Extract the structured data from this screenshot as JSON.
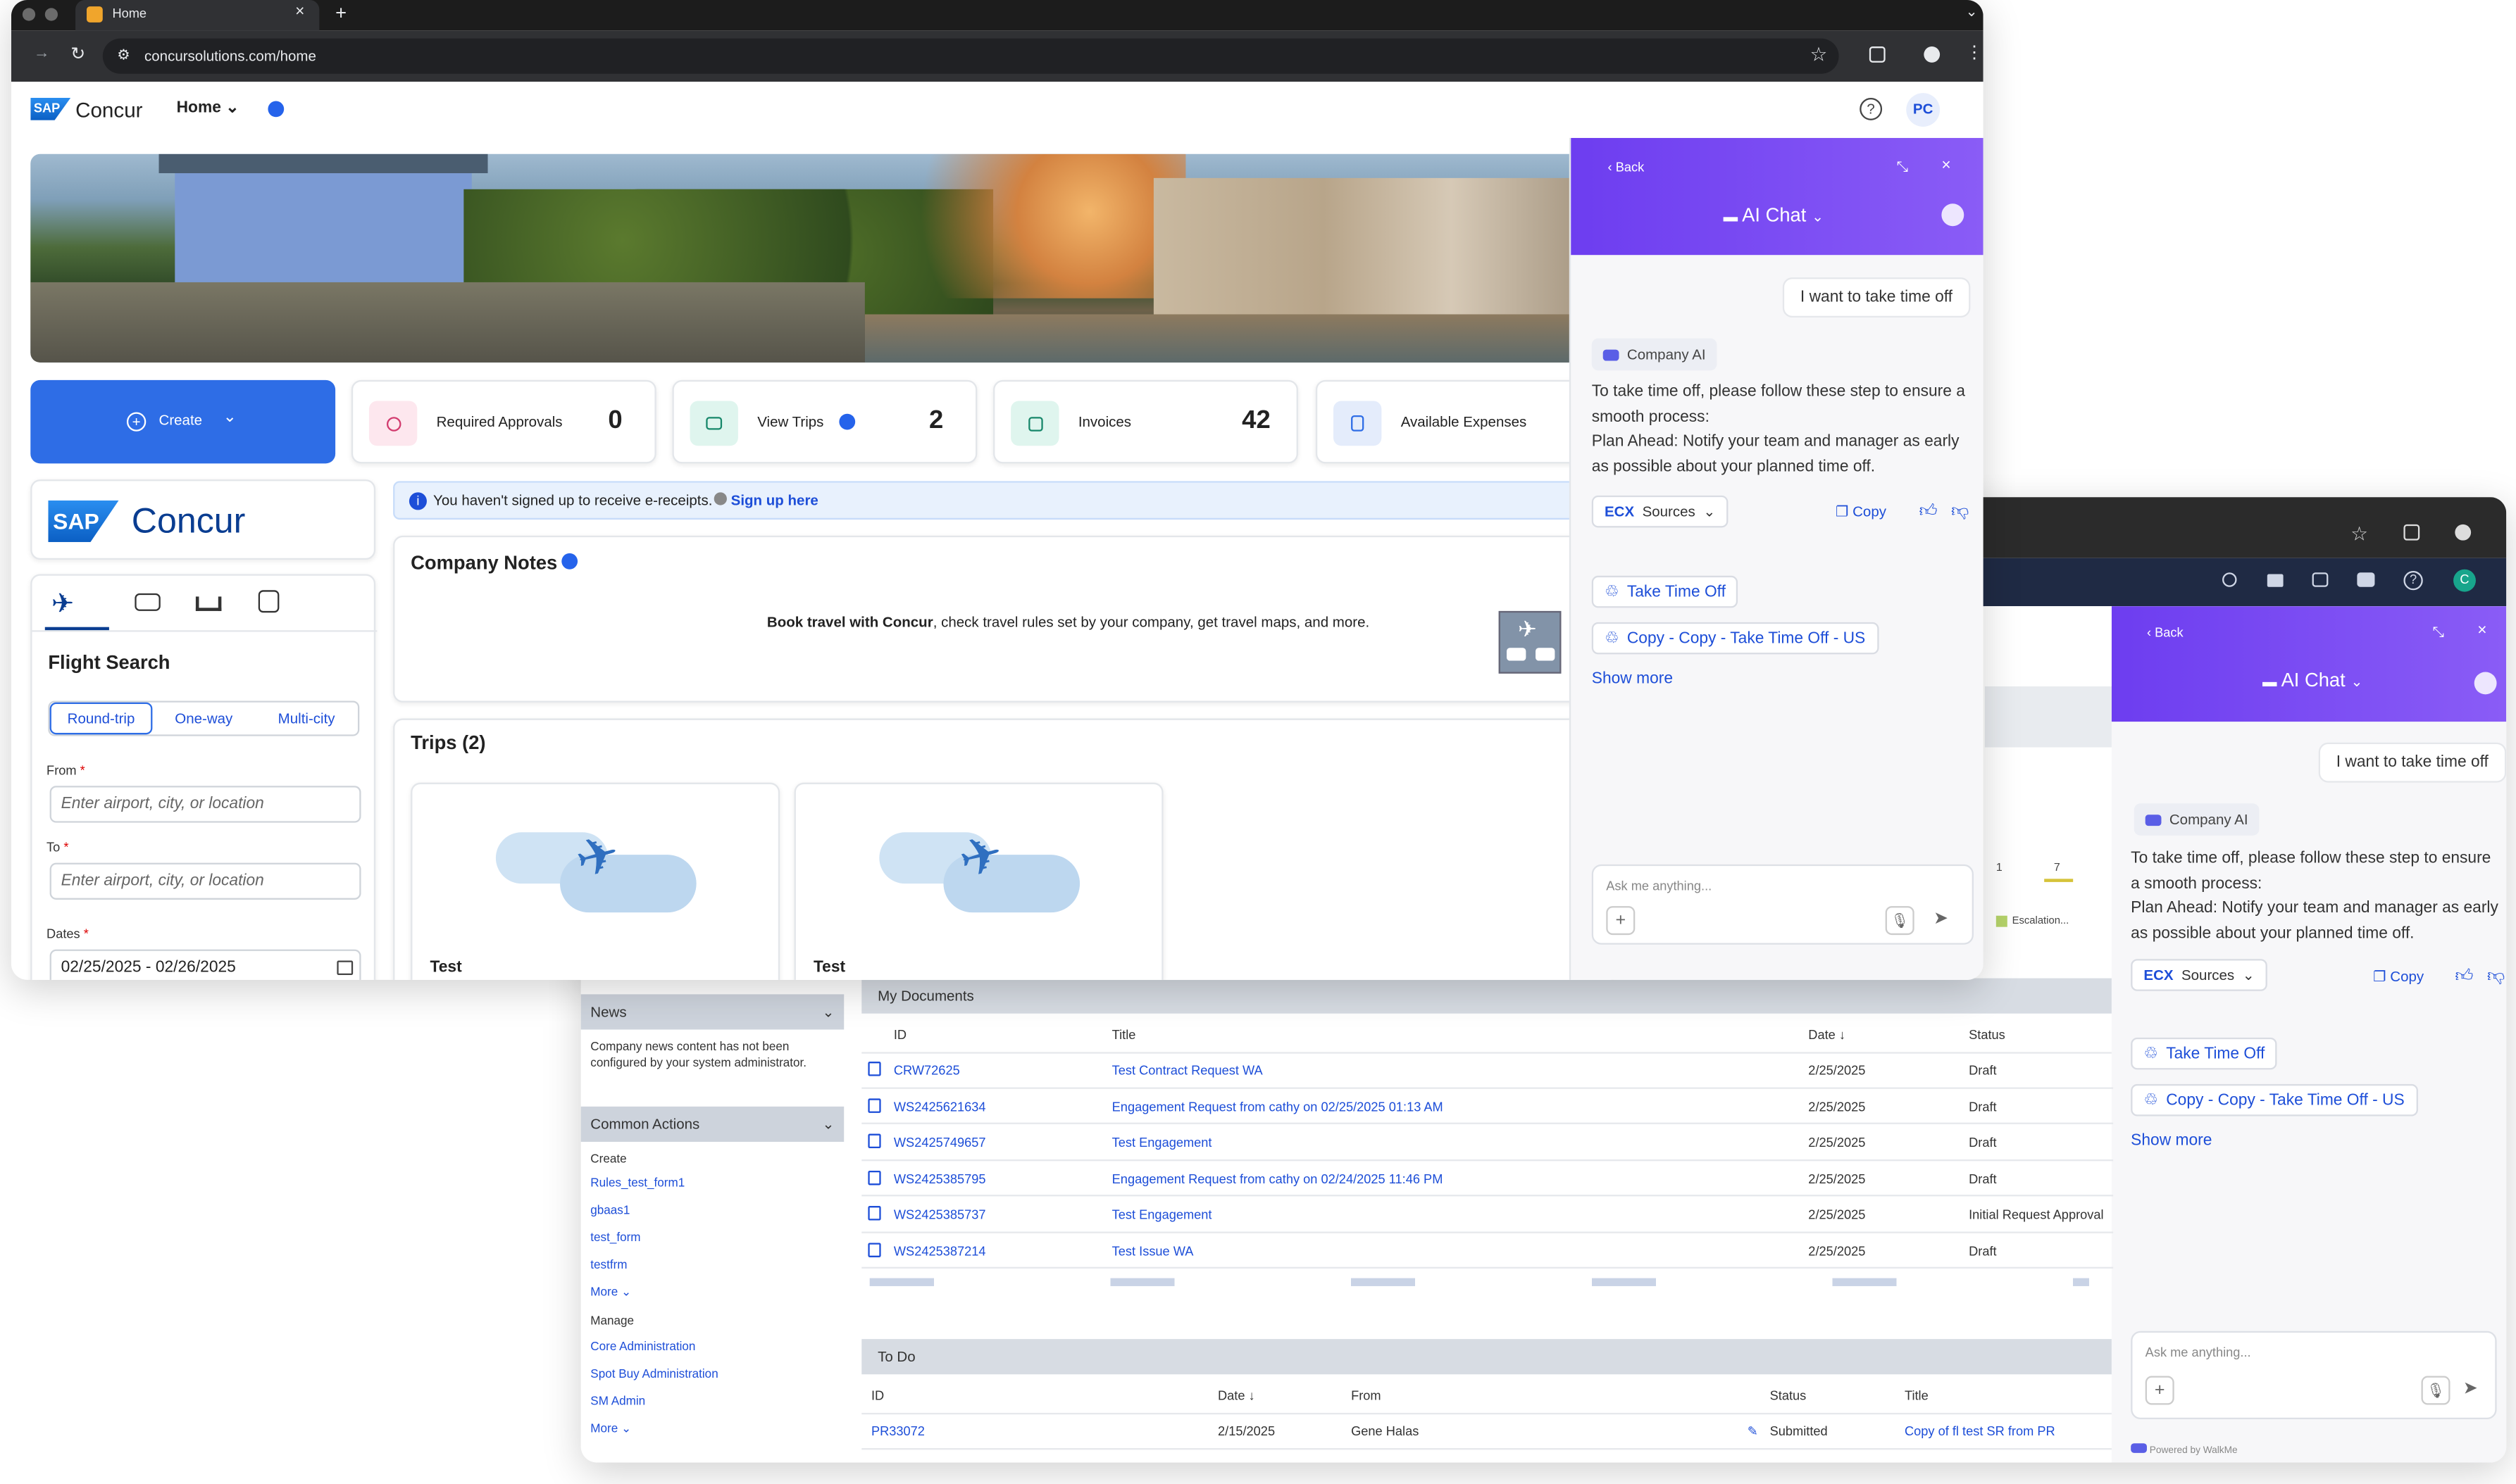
{
  "browser": {
    "tab_title": "Home",
    "url": "concursolutions.com/home"
  },
  "concur": {
    "logo_text": "Concur",
    "home_menu": "Home",
    "avatar": "PC",
    "create_label": "Create",
    "tiles": [
      {
        "label": "Required Approvals",
        "count": "0"
      },
      {
        "label": "View Trips",
        "count": "2"
      },
      {
        "label": "Invoices",
        "count": "42"
      },
      {
        "label": "Available Expenses",
        "count": ""
      }
    ],
    "banner_text": "You haven't signed up to receive e-receipts.",
    "banner_link": "Sign up here",
    "notes_title": "Company Notes",
    "notes_bold": "Book travel with Concur",
    "notes_rest": ", check travel rules set by your company, get travel maps, and more.",
    "trips_title": "Trips (2)",
    "trip_names": [
      "Test",
      "Test"
    ],
    "flight": {
      "title": "Flight Search",
      "modes": [
        "Round-trip",
        "One-way",
        "Multi-city"
      ],
      "from_label": "From",
      "to_label": "To",
      "dates_label": "Dates",
      "from_placeholder": "Enter airport, city, or location",
      "to_placeholder": "Enter airport, city, or location",
      "dates_value": "02/25/2025 - 02/26/2025"
    }
  },
  "chat": {
    "back": "Back",
    "title": "AI Chat",
    "user_msg": "I want to take time off",
    "bot_name": "Company AI",
    "bot_msg": "To take time off, please follow these step to ensure a smooth process:",
    "bot_msg2": "Plan Ahead: Notify your team and manager as early as possible about your planned time off.",
    "sources": "Sources",
    "copy": "Copy",
    "links": [
      "Take Time Off",
      "Copy - Copy - Take Time Off - US"
    ],
    "show_more": "Show more",
    "placeholder": "Ask me anything...",
    "powered": "Powered by WalkMe"
  },
  "backapp": {
    "news_title": "News",
    "news_text": "Company news content has not been configured by your system administrator.",
    "common_actions": "Common Actions",
    "create_label": "Create",
    "create_links": [
      "Rules_test_form1",
      "gbaas1",
      "test_form",
      "testfrm"
    ],
    "more": "More",
    "manage_label": "Manage",
    "manage_links": [
      "Core Administration",
      "Spot Buy Administration",
      "SM Admin"
    ],
    "docs_title": "My Documents",
    "docs_cols": [
      "ID",
      "Title",
      "Date ↓",
      "Status"
    ],
    "docs_rows": [
      {
        "id": "CRW72625",
        "title": "Test Contract Request WA",
        "date": "2/25/2025",
        "status": "Draft"
      },
      {
        "id": "WS2425621634",
        "title": "Engagement Request from cathy on 02/25/2025 01:13 AM",
        "date": "2/25/2025",
        "status": "Draft"
      },
      {
        "id": "WS2425749657",
        "title": "Test Engagement",
        "date": "2/25/2025",
        "status": "Draft"
      },
      {
        "id": "WS2425385795",
        "title": "Engagement Request from cathy on 02/24/2025 11:46 PM",
        "date": "2/25/2025",
        "status": "Draft"
      },
      {
        "id": "WS2425385737",
        "title": "Test Engagement",
        "date": "2/25/2025",
        "status": "Initial Request Approval"
      },
      {
        "id": "WS2425387214",
        "title": "Test Issue WA",
        "date": "2/25/2025",
        "status": "Draft"
      }
    ],
    "todo_title": "To Do",
    "todo_cols": [
      "ID",
      "Date ↓",
      "From",
      "Status",
      "Title"
    ],
    "todo_row": {
      "id": "PR33072",
      "date": "2/15/2025",
      "from": "Gene Halas",
      "status": "Submitted",
      "title": "Copy of fl test SR from PR"
    },
    "chart_labels": [
      "1",
      "7"
    ],
    "chart_legend": "Escalation..."
  }
}
